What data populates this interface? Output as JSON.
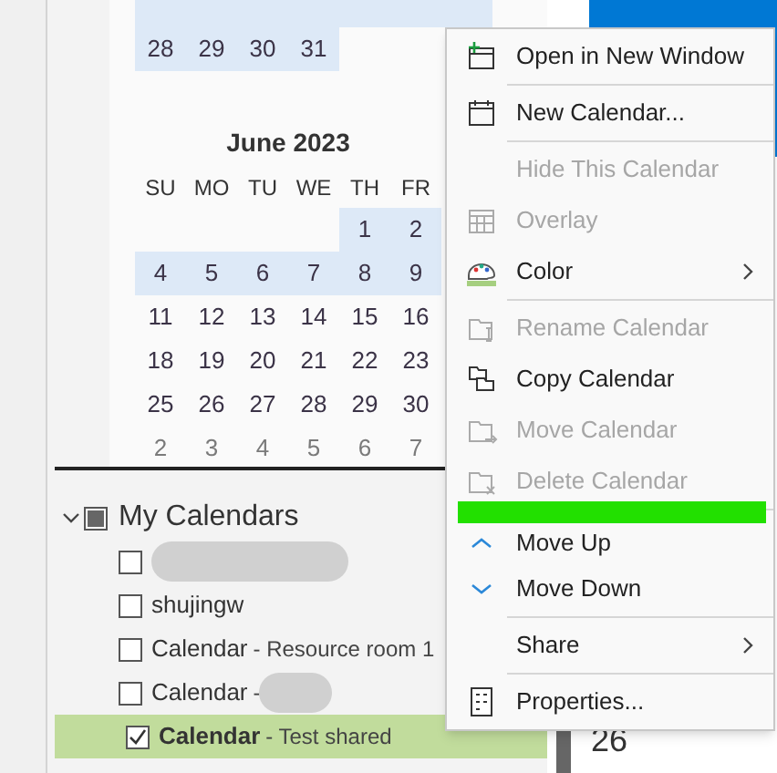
{
  "mini_calendar": {
    "prev_rows": [
      [
        {
          "day": "28",
          "highlighted": true,
          "muted": false
        },
        {
          "day": "29",
          "highlighted": true,
          "muted": false
        },
        {
          "day": "30",
          "highlighted": true,
          "muted": false
        },
        {
          "day": "31",
          "highlighted": true,
          "muted": false
        }
      ]
    ],
    "month_title": "June 2023",
    "weekdays": [
      "SU",
      "MO",
      "TU",
      "WE",
      "TH",
      "FR"
    ],
    "rows": [
      [
        "",
        "",
        "",
        "",
        {
          "day": "1",
          "highlighted": true,
          "muted": false
        },
        {
          "day": "2",
          "highlighted": true,
          "muted": false
        }
      ],
      [
        {
          "day": "4",
          "highlighted": true,
          "muted": false
        },
        {
          "day": "5",
          "highlighted": true,
          "muted": false
        },
        {
          "day": "6",
          "highlighted": true,
          "muted": false
        },
        {
          "day": "7",
          "highlighted": true,
          "muted": false
        },
        {
          "day": "8",
          "highlighted": true,
          "muted": false
        },
        {
          "day": "9",
          "highlighted": true,
          "muted": false
        }
      ],
      [
        {
          "day": "11",
          "highlighted": false,
          "muted": false
        },
        {
          "day": "12",
          "highlighted": false,
          "muted": false
        },
        {
          "day": "13",
          "highlighted": false,
          "muted": false
        },
        {
          "day": "14",
          "highlighted": false,
          "muted": false
        },
        {
          "day": "15",
          "highlighted": false,
          "muted": false
        },
        {
          "day": "16",
          "highlighted": false,
          "muted": false
        }
      ],
      [
        {
          "day": "18",
          "highlighted": false,
          "muted": false
        },
        {
          "day": "19",
          "highlighted": false,
          "muted": false
        },
        {
          "day": "20",
          "highlighted": false,
          "muted": false
        },
        {
          "day": "21",
          "highlighted": false,
          "muted": false
        },
        {
          "day": "22",
          "highlighted": false,
          "muted": false
        },
        {
          "day": "23",
          "highlighted": false,
          "muted": false
        }
      ],
      [
        {
          "day": "25",
          "highlighted": false,
          "muted": false
        },
        {
          "day": "26",
          "highlighted": false,
          "muted": false
        },
        {
          "day": "27",
          "highlighted": false,
          "muted": false
        },
        {
          "day": "28",
          "highlighted": false,
          "muted": false
        },
        {
          "day": "29",
          "highlighted": false,
          "muted": false
        },
        {
          "day": "30",
          "highlighted": false,
          "muted": false
        }
      ],
      [
        {
          "day": "2",
          "highlighted": false,
          "muted": true
        },
        {
          "day": "3",
          "highlighted": false,
          "muted": true
        },
        {
          "day": "4",
          "highlighted": false,
          "muted": true
        },
        {
          "day": "5",
          "highlighted": false,
          "muted": true
        },
        {
          "day": "6",
          "highlighted": false,
          "muted": true
        },
        {
          "day": "7",
          "highlighted": false,
          "muted": true
        }
      ]
    ]
  },
  "calendar_group": {
    "title": "My Calendars",
    "expanded": true,
    "partially_checked": true,
    "items": [
      {
        "kind": "redacted",
        "checked": false,
        "selected": false
      },
      {
        "kind": "plain",
        "name": "shujingw",
        "checked": false,
        "selected": false
      },
      {
        "kind": "named",
        "name": "Calendar",
        "detail": "- Resource room 1",
        "checked": false,
        "selected": false
      },
      {
        "kind": "named_redacted",
        "name": "Calendar",
        "detail": "-",
        "checked": false,
        "selected": false
      },
      {
        "kind": "named",
        "name": "Calendar",
        "detail": "- Test shared",
        "checked": true,
        "selected": true
      }
    ]
  },
  "calendar_view": {
    "day": "26"
  },
  "context_menu": {
    "items": [
      {
        "kind": "item",
        "label": "Open in New Window",
        "disabled": false,
        "submenu": false
      },
      {
        "kind": "separator"
      },
      {
        "kind": "item",
        "label": "New Calendar...",
        "disabled": false,
        "submenu": false
      },
      {
        "kind": "separator"
      },
      {
        "kind": "item",
        "label": "Hide This Calendar",
        "disabled": true,
        "submenu": false
      },
      {
        "kind": "item",
        "label": "Overlay",
        "disabled": true,
        "submenu": false
      },
      {
        "kind": "item",
        "label": "Color",
        "disabled": false,
        "submenu": true
      },
      {
        "kind": "separator"
      },
      {
        "kind": "item",
        "label": "Rename Calendar",
        "disabled": true,
        "submenu": false
      },
      {
        "kind": "item",
        "label": "Copy Calendar",
        "disabled": false,
        "submenu": false
      },
      {
        "kind": "item",
        "label": "Move Calendar",
        "disabled": true,
        "submenu": false
      },
      {
        "kind": "item",
        "label": "Delete Calendar",
        "disabled": true,
        "submenu": false
      },
      {
        "kind": "separator"
      },
      {
        "kind": "item",
        "label": "Move Up",
        "disabled": false,
        "submenu": false
      },
      {
        "kind": "item",
        "label": "Move Down",
        "disabled": false,
        "submenu": false
      },
      {
        "kind": "separator"
      },
      {
        "kind": "item",
        "label": "Share",
        "disabled": false,
        "submenu": true
      },
      {
        "kind": "separator"
      },
      {
        "kind": "item",
        "label": "Properties...",
        "disabled": false,
        "submenu": false
      }
    ]
  }
}
